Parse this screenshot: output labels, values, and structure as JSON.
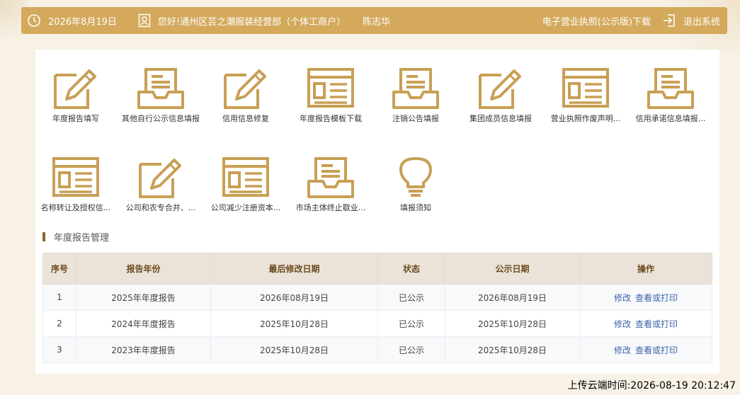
{
  "topbar": {
    "date": "2026年8月19日",
    "greeting": "您好!通州区芸之潮服装经营部（个体工商户）",
    "user_name": "陈志华",
    "license_link": "电子营业执照(公示版)下载",
    "logout": "退出系统"
  },
  "colors": {
    "accent": "#d4a95c",
    "icon_gold": "#c89f55",
    "link_blue": "#3b64a8",
    "header_bg": "#ebe3d9"
  },
  "tiles": [
    {
      "label": "年度报告填写",
      "icon": "edit-icon"
    },
    {
      "label": "其他自行公示信息填报",
      "icon": "inbox-icon"
    },
    {
      "label": "信用信息修复",
      "icon": "edit-icon"
    },
    {
      "label": "年度报告模板下载",
      "icon": "document-window-icon"
    },
    {
      "label": "注销公告填报",
      "icon": "inbox-icon"
    },
    {
      "label": "集团成员信息填报",
      "icon": "edit-icon"
    },
    {
      "label": "营业执照作废声明...",
      "icon": "document-window-icon"
    },
    {
      "label": "信用承诺信息填报...",
      "icon": "inbox-icon"
    },
    {
      "label": "名称转让及授权信...",
      "icon": "document-window-icon"
    },
    {
      "label": "公司和农专合并、...",
      "icon": "edit-icon"
    },
    {
      "label": "公司减少注册资本...",
      "icon": "document-window-icon"
    },
    {
      "label": "市场主体终止歇业...",
      "icon": "inbox-icon"
    },
    {
      "label": "填报须知",
      "icon": "lightbulb-icon"
    }
  ],
  "section": {
    "title": "年度报告管理"
  },
  "table": {
    "headers": [
      "序号",
      "报告年份",
      "最后修改日期",
      "状态",
      "公示日期",
      "操作"
    ],
    "rows": [
      {
        "no": "1",
        "year": "2025年年度报告",
        "modified": "2026年08月19日",
        "status": "已公示",
        "published": "2026年08月19日",
        "edit": "修改",
        "view": "查看或打印"
      },
      {
        "no": "2",
        "year": "2024年年度报告",
        "modified": "2025年10月28日",
        "status": "已公示",
        "published": "2025年10月28日",
        "edit": "修改",
        "view": "查看或打印"
      },
      {
        "no": "3",
        "year": "2023年年度报告",
        "modified": "2025年10月28日",
        "status": "已公示",
        "published": "2025年10月28日",
        "edit": "修改",
        "view": "查看或打印"
      }
    ]
  },
  "footer": {
    "upload_time": "上传云端时间:2026-08-19 20:12:47"
  }
}
